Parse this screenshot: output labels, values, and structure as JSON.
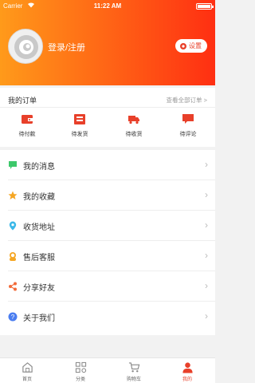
{
  "status_bar": {
    "carrier": "Carrier",
    "time": "11:22 AM"
  },
  "header": {
    "login_label": "登录/注册",
    "settings_label": "设置"
  },
  "orders": {
    "title": "我的订单",
    "view_all": "查看全部订单 >",
    "items": [
      {
        "label": "待付款",
        "icon": "wallet-icon"
      },
      {
        "label": "待发货",
        "icon": "package-icon"
      },
      {
        "label": "待收货",
        "icon": "truck-icon"
      },
      {
        "label": "待评论",
        "icon": "comment-icon"
      }
    ]
  },
  "menu": {
    "items": [
      {
        "label": "我的消息",
        "icon": "message-icon",
        "color": "#3cc86a"
      },
      {
        "label": "我的收藏",
        "icon": "star-icon",
        "color": "#f5a623"
      },
      {
        "label": "收货地址",
        "icon": "location-icon",
        "color": "#3bb8e8"
      },
      {
        "label": "售后客服",
        "icon": "customer-service-icon",
        "color": "#f5a623"
      },
      {
        "label": "分享好友",
        "icon": "share-icon",
        "color": "#f26b3a"
      },
      {
        "label": "关于我们",
        "icon": "question-icon",
        "color": "#4a7df0"
      }
    ],
    "chevron": "›"
  },
  "tabbar": {
    "items": [
      {
        "label": "首页",
        "icon": "home-icon",
        "active": false
      },
      {
        "label": "分类",
        "icon": "category-icon",
        "active": false
      },
      {
        "label": "购物车",
        "icon": "cart-icon",
        "active": false
      },
      {
        "label": "我的",
        "icon": "profile-icon",
        "active": true
      }
    ]
  },
  "colors": {
    "accent": "#e8402a",
    "header_start": "#ff9a1a",
    "header_end": "#ff2f12"
  }
}
